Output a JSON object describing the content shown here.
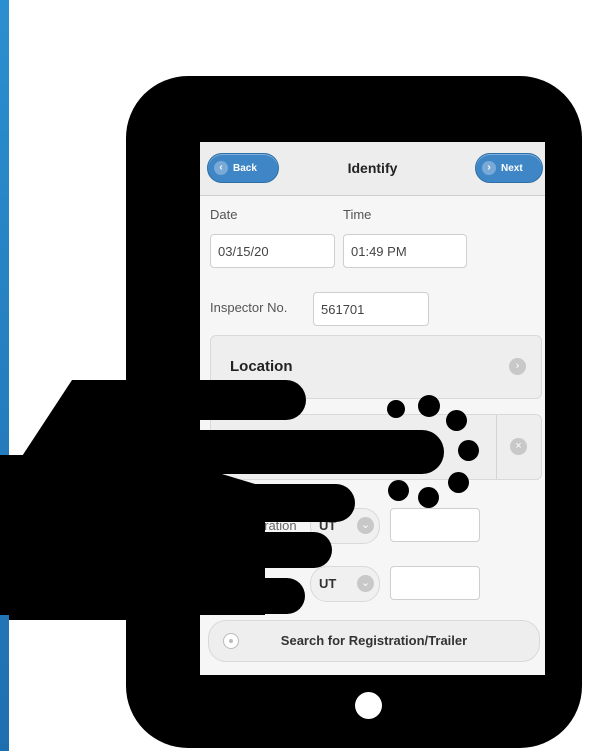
{
  "header": {
    "back_label": "Back",
    "title": "Identify",
    "next_label": "Next"
  },
  "form": {
    "date_label": "Date",
    "time_label": "Time",
    "date_value": "03/15/20",
    "time_value": "01:49 PM",
    "inspector_label": "Inspector No.",
    "inspector_value": "561701"
  },
  "location": {
    "label": "Location"
  },
  "registration": {
    "label": "stration",
    "state_1": "UT",
    "state_2": "UT",
    "plate_1": "",
    "plate_2": ""
  },
  "search": {
    "label": "Search for Registration/Trailer"
  },
  "icons": {
    "back": "chevron-left-icon",
    "next": "chevron-right-icon",
    "location": "chevron-right-circle-icon",
    "clear": "close-circle-icon",
    "select": "chevron-down-circle-icon",
    "search": "radio-circle-icon",
    "spinner": "loading-spinner-icon",
    "overlay": "hand-tap-icon"
  },
  "colors": {
    "accent": "#3f86c6",
    "stripe": "#2a8fd0"
  }
}
